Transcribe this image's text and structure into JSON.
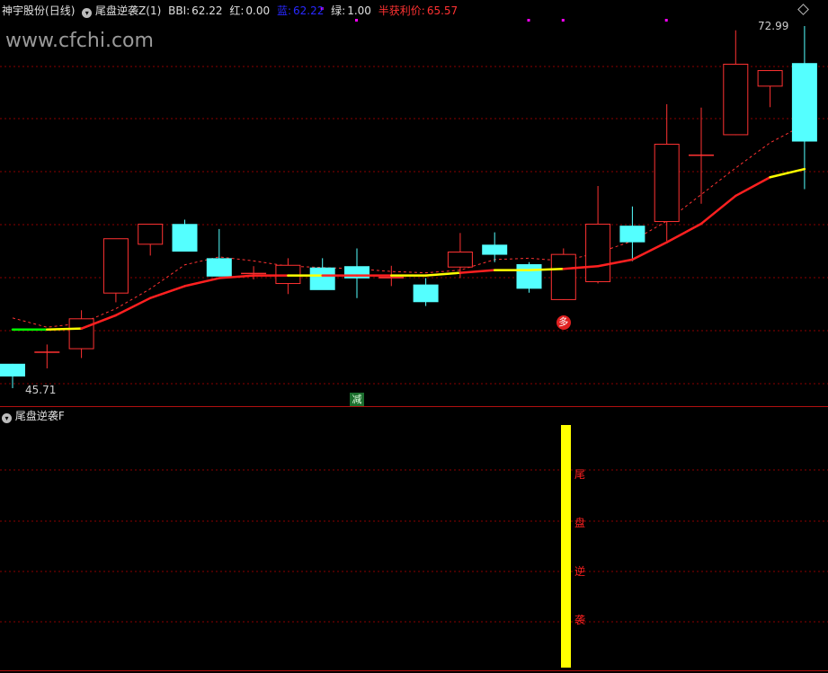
{
  "header": {
    "stock_name": "神宇股份",
    "period": "(日线)",
    "indicator_name": "尾盘逆袭Z(1)",
    "bbi_label": "BBI:",
    "bbi_value": "62.22",
    "red_label": "红:",
    "red_value": "0.00",
    "blue_label": "蓝:",
    "blue_value": "62.22",
    "green_label": "绿:",
    "green_value": "1.00",
    "profit_label": "半获利价:",
    "profit_value": "65.57"
  },
  "watermark": "www.cfchi.com",
  "price_high_label": "72.99",
  "price_low_label": "45.71",
  "markers": {
    "duo": "多",
    "jian": "减"
  },
  "lower_panel": {
    "title": "尾盘逆袭F",
    "signal_chars": [
      "尾",
      "盘",
      "逆",
      "袭"
    ]
  },
  "colors": {
    "up": "#ff3232",
    "down": "#54ffff",
    "bbi_red": "#ff2020",
    "bbi_yellow": "#ffff00",
    "bbi_green": "#00ff00",
    "profit_line": "#ff3232",
    "grid": "#8b0000",
    "magenta": "#ff00ff",
    "signal_bar": "#ffff00"
  },
  "chart_data": {
    "type": "candlestick",
    "price_range": [
      45.71,
      72.99
    ],
    "candles": [
      {
        "o": 47.55,
        "h": 47.55,
        "l": 45.71,
        "c": 46.59
      },
      {
        "o": 48.47,
        "h": 49.0,
        "l": 47.2,
        "c": 48.47
      },
      {
        "o": 48.65,
        "h": 51.58,
        "l": 47.98,
        "c": 50.97
      },
      {
        "o": 52.84,
        "h": 56.9,
        "l": 52.18,
        "c": 57.0
      },
      {
        "o": 56.52,
        "h": 57.2,
        "l": 55.7,
        "c": 58.1
      },
      {
        "o": 58.08,
        "h": 58.4,
        "l": 56.5,
        "c": 56.0
      },
      {
        "o": 55.5,
        "h": 57.7,
        "l": 54.87,
        "c": 54.12
      },
      {
        "o": 54.4,
        "h": 54.9,
        "l": 53.9,
        "c": 54.4
      },
      {
        "o": 53.56,
        "h": 55.5,
        "l": 52.8,
        "c": 55.0
      },
      {
        "o": 54.8,
        "h": 55.5,
        "l": 53.6,
        "c": 53.1
      },
      {
        "o": 54.9,
        "h": 56.24,
        "l": 52.5,
        "c": 53.98
      },
      {
        "o": 53.98,
        "h": 54.93,
        "l": 53.4,
        "c": 54.1
      },
      {
        "o": 53.52,
        "h": 54.0,
        "l": 51.9,
        "c": 52.19
      },
      {
        "o": 54.8,
        "h": 57.4,
        "l": 54.0,
        "c": 56.0
      },
      {
        "o": 56.52,
        "h": 57.45,
        "l": 55.2,
        "c": 55.76
      },
      {
        "o": 55.05,
        "h": 55.2,
        "l": 52.9,
        "c": 53.2
      },
      {
        "o": 52.35,
        "h": 56.24,
        "l": 52.35,
        "c": 55.82
      },
      {
        "o": 53.7,
        "h": 60.94,
        "l": 53.6,
        "c": 58.1
      },
      {
        "o": 57.95,
        "h": 59.4,
        "l": 55.28,
        "c": 56.7
      },
      {
        "o": 58.23,
        "h": 67.1,
        "l": 56.8,
        "c": 64.12
      },
      {
        "o": 63.31,
        "h": 66.85,
        "l": 59.6,
        "c": 63.31
      },
      {
        "o": 64.77,
        "h": 72.67,
        "l": 64.77,
        "c": 70.15
      },
      {
        "o": 68.43,
        "h": 69.67,
        "l": 66.88,
        "c": 69.67
      },
      {
        "o": 70.2,
        "h": 72.99,
        "l": 60.7,
        "c": 64.29
      }
    ],
    "bbi_line": [
      50.13,
      50.13,
      50.2,
      51.2,
      52.5,
      53.4,
      54.0,
      54.2,
      54.2,
      54.2,
      54.2,
      54.2,
      54.2,
      54.4,
      54.6,
      54.6,
      54.7,
      54.9,
      55.4,
      56.7,
      58.1,
      60.2,
      61.6,
      62.22
    ],
    "bbi_colors": [
      "green",
      "green",
      "yellow",
      "red",
      "red",
      "red",
      "red",
      "red",
      "red",
      "yellow",
      "red",
      "red",
      "yellow",
      "yellow",
      "red",
      "yellow",
      "yellow",
      "red",
      "red",
      "red",
      "red",
      "red",
      "red",
      "yellow"
    ],
    "profit_line": [
      51.0,
      50.3,
      50.6,
      51.7,
      53.2,
      55.0,
      55.6,
      55.3,
      54.9,
      54.8,
      54.7,
      54.5,
      54.4,
      54.6,
      55.4,
      55.5,
      55.3,
      55.9,
      56.8,
      58.3,
      60.3,
      62.3,
      64.2,
      65.57
    ],
    "signals": {
      "duo_index": 16,
      "jian_index": 10,
      "lower_bar_index": 16
    }
  }
}
